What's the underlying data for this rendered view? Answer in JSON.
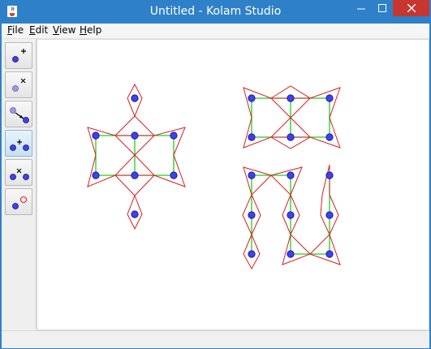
{
  "window": {
    "title": "Untitled - Kolam Studio",
    "icon": "java-cup-icon"
  },
  "menu": [
    {
      "mnemonic": "F",
      "rest": "ile"
    },
    {
      "mnemonic": "E",
      "rest": "dit"
    },
    {
      "mnemonic": "V",
      "rest": "iew"
    },
    {
      "mnemonic": "H",
      "rest": "elp"
    }
  ],
  "tools": [
    {
      "name": "add-dot-tool",
      "icon": "add-dot-icon",
      "selected": false
    },
    {
      "name": "remove-dot-tool",
      "icon": "remove-dot-icon",
      "selected": false
    },
    {
      "name": "move-dot-tool",
      "icon": "move-dot-icon",
      "selected": false
    },
    {
      "name": "add-connection-tool",
      "icon": "add-connection-icon",
      "selected": true
    },
    {
      "name": "remove-connection-tool",
      "icon": "remove-connection-icon",
      "selected": false
    },
    {
      "name": "loop-tool",
      "icon": "loop-icon",
      "selected": false
    }
  ],
  "colors": {
    "dot": "#4040f0",
    "connection": "#22cc22",
    "curve": "#d42020",
    "titlebar": "#2e80c8",
    "close": "#c7372f"
  }
}
